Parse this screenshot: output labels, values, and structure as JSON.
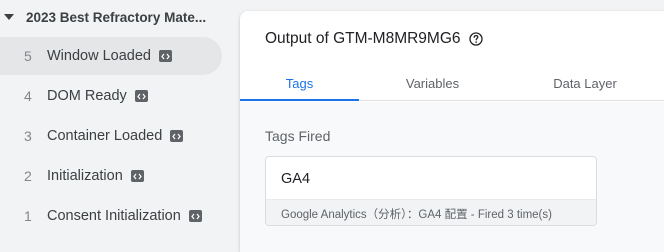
{
  "sidebar": {
    "container_title": "2023 Best Refractory Mate...",
    "events": [
      {
        "num": "5",
        "label": "Window Loaded",
        "selected": true
      },
      {
        "num": "4",
        "label": "DOM Ready"
      },
      {
        "num": "3",
        "label": "Container Loaded"
      },
      {
        "num": "2",
        "label": "Initialization"
      },
      {
        "num": "1",
        "label": "Consent Initialization"
      }
    ]
  },
  "panel": {
    "title": "Output of GTM-M8MR9MG6",
    "tabs": [
      {
        "label": "Tags",
        "active": true
      },
      {
        "label": "Variables"
      },
      {
        "label": "Data Layer"
      }
    ],
    "section_title": "Tags Fired",
    "tag": {
      "name": "GA4",
      "detail": "Google Analytics（分析）：GA4 配置 - Fired 3 time(s)"
    }
  },
  "colors": {
    "accent": "#1a73e8",
    "sidebar_bg": "#f1f3f4",
    "selected_bg": "#e4e6e8",
    "badge": "#5f6368"
  },
  "icons": {
    "collapse": "caret-down-icon",
    "event_badge": "code-icon",
    "help": "help-circle-icon"
  }
}
